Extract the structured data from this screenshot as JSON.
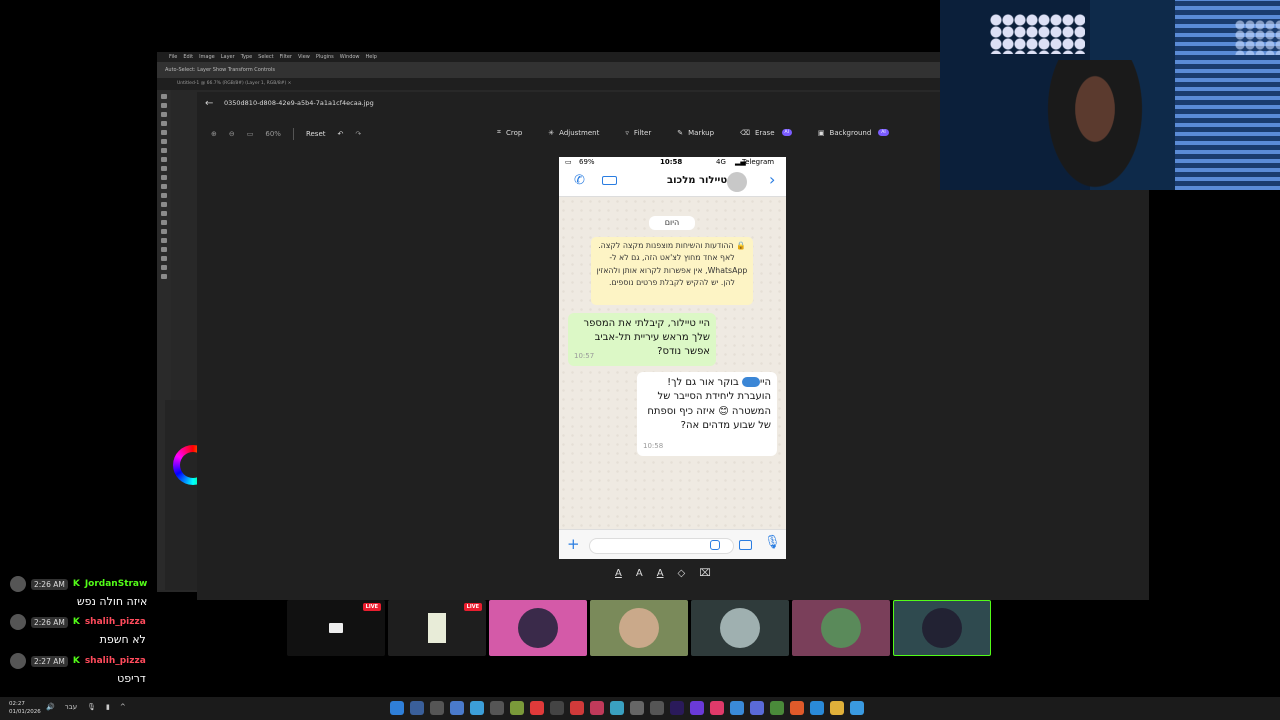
{
  "photoshop": {
    "menu": [
      "File",
      "Edit",
      "Image",
      "Layer",
      "Type",
      "Select",
      "Filter",
      "View",
      "Plugins",
      "Window",
      "Help"
    ],
    "options": "Auto-Select:   Layer   Show Transform Controls",
    "tab": "Untitled-1 @ 66.7% (RGB/8#) (Layer 1, RGB/8#) ×"
  },
  "editor": {
    "filename": "0350d810-d808-42e9-a5b4-7a1a1cf4ecaa.jpg",
    "zoom": "60%",
    "reset": "Reset",
    "tools": [
      {
        "label": "Crop",
        "icon": "crop-icon"
      },
      {
        "label": "Adjustment",
        "icon": "adjust-icon"
      },
      {
        "label": "Filter",
        "icon": "filter-icon"
      },
      {
        "label": "Markup",
        "icon": "pen-icon"
      },
      {
        "label": "Erase",
        "icon": "eraser-icon",
        "badge": "AI"
      },
      {
        "label": "Background",
        "icon": "background-icon",
        "badge": "AI"
      }
    ]
  },
  "phone": {
    "battery": "69%",
    "time": "10:58",
    "network": "4G",
    "carrier": "Telegram",
    "contact_name": "טיילור מלכוב",
    "day_label": "היום",
    "encryption_notice": "🔒 ההודעות והשיחות מוצפנות מקצה לקצה. לאף אחד מחוץ לצ'אט הזה, גם לא ל-WhatsApp, אין אפשרות לקרוא אותן ולהאזין להן. יש להקיש לקבלת פרטים נוספים.",
    "msg_out": "היי טיילור, קיבלתי את המספר שלך מראש עיריית תל-אביב אפשר נודס?",
    "msg_out_time": "10:57",
    "msg_in_prefix": "היי",
    "msg_in_rest": "בוקר אור גם לך! הועברת ליחידת הסייבר של המשטרה 😊 איזה כיף וספתח של שבוע מדהים אה?",
    "msg_in_time": "10:58"
  },
  "chat": [
    {
      "time": "2:26 AM",
      "user": "JordanStraw",
      "message": "איזה חולה נפש",
      "color": "#53fc18"
    },
    {
      "time": "2:26 AM",
      "user": "shalih_pizza",
      "message": "לא חשפת",
      "color": "#ff4b5c"
    },
    {
      "time": "2:27 AM",
      "user": "shalih_pizza",
      "message": "דריפט",
      "color": "#ff4b5c"
    }
  ],
  "tiles": {
    "live_label": "LIVE",
    "colors": [
      "#111111",
      "#1e1e1e",
      "#d45aa8",
      "#7a8a5a",
      "#2f3b3b",
      "#7a3f5a",
      "#2f4a4f"
    ]
  },
  "taskbar": {
    "time": "02:27",
    "date": "01/01/2026",
    "lang": "עבר"
  }
}
